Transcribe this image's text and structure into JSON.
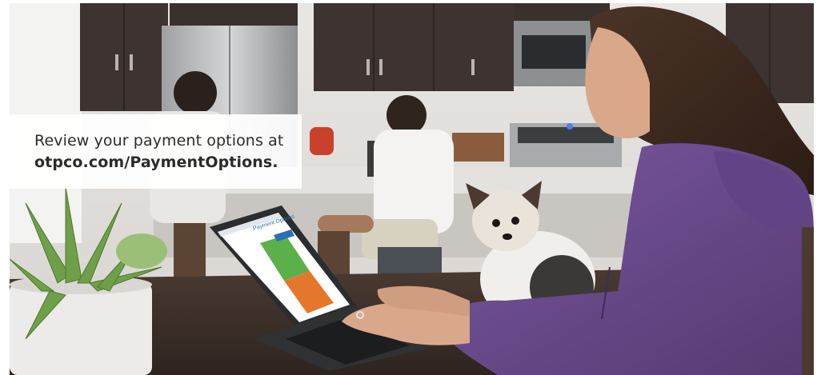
{
  "banner": {
    "line1": "Review your payment options at",
    "line2": "otpco.com/PaymentOptions."
  },
  "laptop_screen": {
    "heading": "Payment Options"
  },
  "colors": {
    "overlay_background": "#ffffff",
    "caption_text": "#2b2b2b",
    "hoodie": "#6e4c8a",
    "cabinet": "#3d3330",
    "screen_green": "#5bb04a",
    "screen_orange": "#e5772d",
    "screen_blue": "#2c6fb7"
  }
}
